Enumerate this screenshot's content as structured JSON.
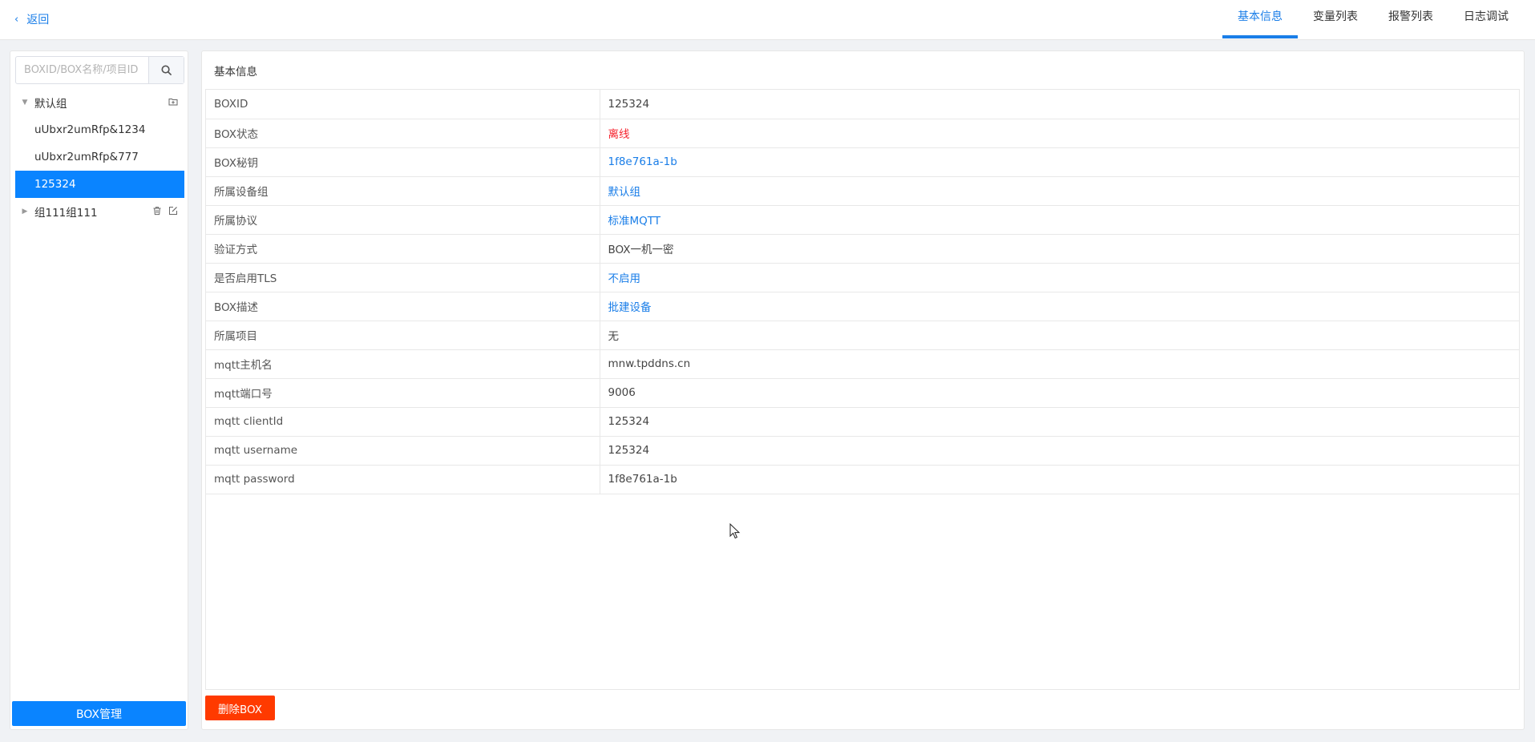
{
  "header": {
    "back_label": "返回",
    "tabs": [
      {
        "label": "基本信息",
        "active": true
      },
      {
        "label": "变量列表",
        "active": false
      },
      {
        "label": "报警列表",
        "active": false
      },
      {
        "label": "日志调试",
        "active": false
      }
    ]
  },
  "sidebar": {
    "search": {
      "placeholder": "BOXID/BOX名称/项目ID",
      "value": ""
    },
    "groups": [
      {
        "label": "默认组",
        "expanded": true,
        "items": [
          "uUbxr2umRfp&1234",
          "uUbxr2umRfp&777",
          "125324"
        ],
        "selected": "125324"
      },
      {
        "label": "组111组111",
        "expanded": false
      }
    ],
    "manage_button": "BOX管理"
  },
  "main": {
    "title": "基本信息",
    "rows": [
      {
        "key": "BOXID",
        "value": "125324",
        "style": "normal"
      },
      {
        "key": "BOX状态",
        "value": "离线",
        "style": "red"
      },
      {
        "key": "BOX秘钥",
        "value": "1f8e761a-1b",
        "style": "blue"
      },
      {
        "key": "所属设备组",
        "value": "默认组",
        "style": "blue"
      },
      {
        "key": "所属协议",
        "value": "标准MQTT",
        "style": "blue"
      },
      {
        "key": "验证方式",
        "value": "BOX一机一密",
        "style": "normal"
      },
      {
        "key": "是否启用TLS",
        "value": "不启用",
        "style": "blue"
      },
      {
        "key": "BOX描述",
        "value": "批建设备",
        "style": "blue"
      },
      {
        "key": "所属项目",
        "value": "无",
        "style": "normal"
      },
      {
        "key": "mqtt主机名",
        "value": "mnw.tpddns.cn",
        "style": "normal"
      },
      {
        "key": "mqtt端口号",
        "value": "9006",
        "style": "normal"
      },
      {
        "key": "mqtt clientId",
        "value": "125324",
        "style": "normal"
      },
      {
        "key": "mqtt username",
        "value": "125324",
        "style": "normal"
      },
      {
        "key": "mqtt password",
        "value": "1f8e761a-1b",
        "style": "normal"
      }
    ],
    "delete_button": "删除BOX"
  },
  "colors": {
    "accent": "#1a7ee8",
    "selected_bg": "#0a84ff",
    "danger": "#ff3a00",
    "status_offline": "#f5222d"
  }
}
